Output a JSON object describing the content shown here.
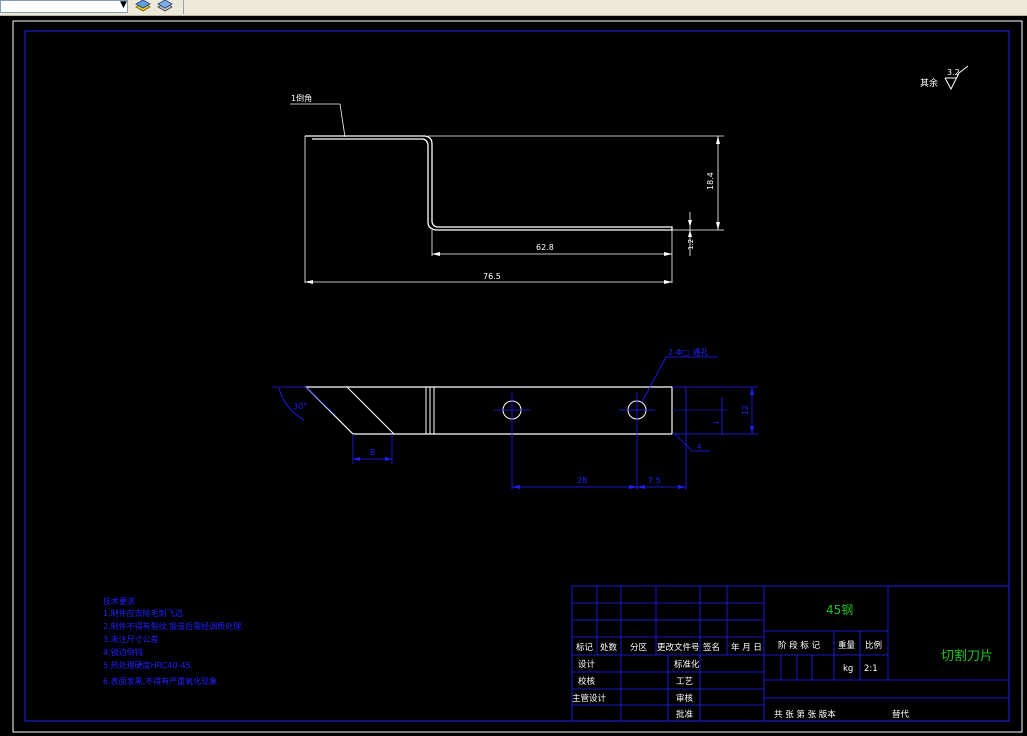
{
  "toolbar": {
    "combo_value": "",
    "icons": [
      "layer-icon",
      "layer-state-icon"
    ]
  },
  "drawing": {
    "title": "切割刀片",
    "material": "45钢",
    "scale": "2:1",
    "weight_unit": "kg",
    "roughness": {
      "label": "其余",
      "value": "3.2"
    },
    "chamfer_note": "1倒角",
    "hole_note": "2-Φ□ 通孔",
    "notes": [
      "技术要求",
      "1.制件应去除毛刺飞边.",
      "2.制件不得有裂纹,锻造后需经调质处理.",
      "3.未注尺寸公差.",
      "4.锐边倒钝.",
      "5.热处理硬度HRC40-45.",
      "6.表面发黑,不得有严重氧化现象."
    ],
    "dims": {
      "top_width": "76.5",
      "top_bottom": "62.8",
      "top_height": "18.4",
      "top_thick": "1.2",
      "plan_hole_spacing": "28",
      "plan_edge": "7.5",
      "plan_height": "12",
      "plan_small": "1",
      "plan_left": "8",
      "plan_angle": "30°",
      "plan_t": "4"
    },
    "title_block": {
      "row_labels": [
        "标记",
        "处数",
        "分区",
        "更改文件号",
        "签名",
        "年 月 日"
      ],
      "left_labels": [
        "设计",
        "校核",
        "主管设计"
      ],
      "mid_labels": [
        "标准化",
        "工艺",
        "审核",
        "批准"
      ],
      "stage_label": "阶 段 标 记",
      "weight_label": "重量",
      "scale_label": "比例",
      "sheet_text": "共  张  第  张  版本",
      "replace_label": "替代"
    }
  }
}
